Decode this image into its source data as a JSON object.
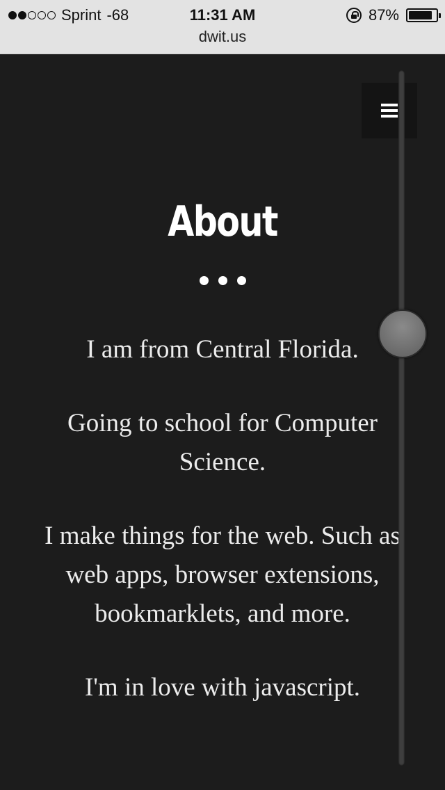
{
  "status_bar": {
    "carrier": "Sprint",
    "signal_value": "-68",
    "signal_bars_filled": 2,
    "signal_bars_total": 5,
    "time": "11:31 AM",
    "battery_percent": "87%",
    "battery_level": 0.87
  },
  "browser": {
    "url": "dwit.us"
  },
  "page": {
    "menu_icon": "hamburger-icon",
    "section_title": "About",
    "paragraphs": [
      "I am from Central Florida.",
      "Going to school for Computer Science.",
      "I make things for the web. Such as web apps, browser extensions, bookmarklets, and more.",
      "I'm in love with javascript."
    ]
  },
  "scroll_slider": {
    "position": 0.37
  },
  "colors": {
    "page_background": "#1c1c1c",
    "status_background": "#e3e3e3",
    "text": "#ececec",
    "title": "#ffffff"
  }
}
